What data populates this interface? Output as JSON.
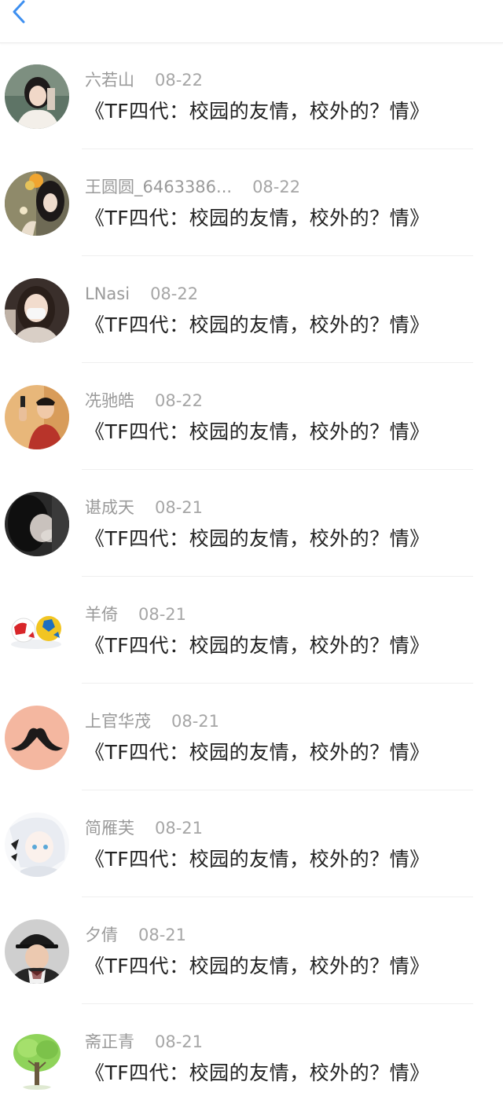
{
  "header": {
    "back_icon": "chevron-left-icon",
    "accent": "#3d8ff0"
  },
  "rows": [
    {
      "username": "六若山",
      "date": "08-22",
      "title": "《TF四代：校园的友情，校外的？情》",
      "avatar": "woman-portrait"
    },
    {
      "username": "王圆圆_6463386...",
      "date": "08-22",
      "title": "《TF四代：校园的友情，校外的？情》",
      "avatar": "woman-flowers"
    },
    {
      "username": "LNasi",
      "date": "08-22",
      "title": "《TF四代：校园的友情，校外的？情》",
      "avatar": "woman-mask"
    },
    {
      "username": "冼驰皓",
      "date": "08-22",
      "title": "《TF四代：校园的友情，校外的？情》",
      "avatar": "man-phone"
    },
    {
      "username": "谌成天",
      "date": "08-21",
      "title": "《TF四代：校园的友情，校外的？情》",
      "avatar": "dark-hair-portrait"
    },
    {
      "username": "羊倚",
      "date": "08-21",
      "title": "《TF四代：校园的友情，校外的？情》",
      "avatar": "soccer-balls"
    },
    {
      "username": "上官华茂",
      "date": "08-21",
      "title": "《TF四代：校园的友情，校外的？情》",
      "avatar": "mustache"
    },
    {
      "username": "简雁芙",
      "date": "08-21",
      "title": "《TF四代：校园的友情，校外的？情》",
      "avatar": "anime-girl"
    },
    {
      "username": "夕倩",
      "date": "08-21",
      "title": "《TF四代：校园的友情，校外的？情》",
      "avatar": "man-cap"
    },
    {
      "username": "斋正青",
      "date": "08-21",
      "title": "《TF四代：校园的友情，校外的？情》",
      "avatar": "tree"
    }
  ]
}
